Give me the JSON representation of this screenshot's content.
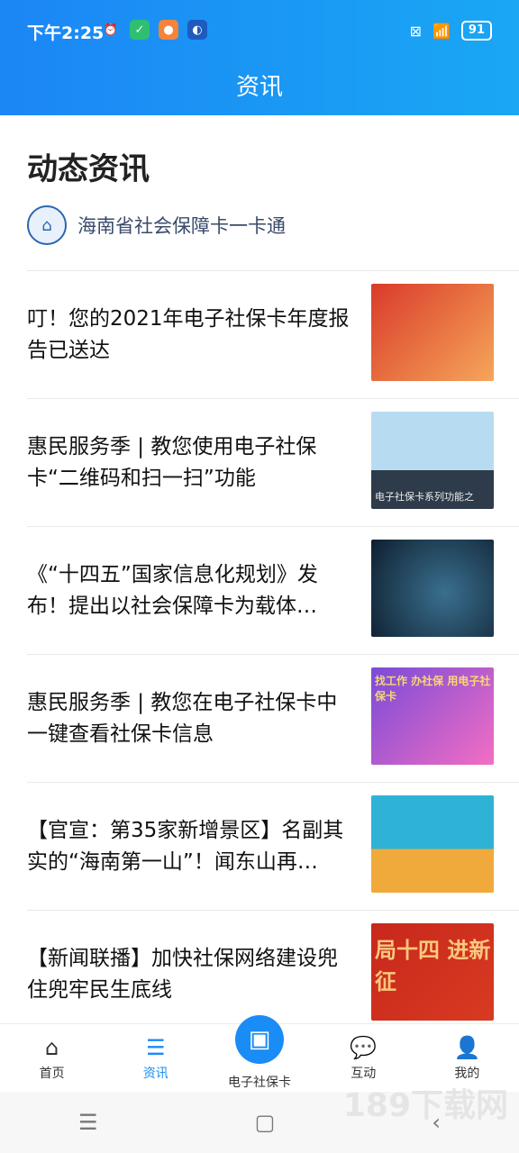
{
  "status": {
    "time": "下午2:25",
    "battery": "91"
  },
  "header": {
    "title": "资讯"
  },
  "section": {
    "title": "动态资讯",
    "source_name": "海南省社会保障卡一卡通"
  },
  "news": [
    {
      "title": "叮！您的2021年电子社保卡年度报告已送达",
      "thumb_caption": "",
      "thumb_color_1": "#d93b2a",
      "thumb_color_2": "#f6a65a"
    },
    {
      "title": "惠民服务季 | 教您使用电子社保卡“二维码和扫一扫”功能",
      "thumb_caption": "电子社保卡系列功能之",
      "thumb_color_1": "#b7dcf2",
      "thumb_color_2": "#2e3b4a"
    },
    {
      "title": "《“十四五”国家信息化规划》发布！提出以社会保障卡为载体…",
      "thumb_caption": "",
      "thumb_color_1": "#0e1f2f",
      "thumb_color_2": "#3a6f8e"
    },
    {
      "title": "惠民服务季 | 教您在电子社保卡中一键查看社保卡信息",
      "thumb_caption": "找工作 办社保 用电子社保卡",
      "thumb_color_1": "#7a4bd8",
      "thumb_color_2": "#f36ec3"
    },
    {
      "title": "【官宣：第35家新增景区】名副其实的“海南第一山”！闻东山再…",
      "thumb_caption": "",
      "thumb_color_1": "#2eb3d6",
      "thumb_color_2": "#f0a93b"
    },
    {
      "title": "【新闻联播】加快社保网络建设兜住兜牢民生底线",
      "thumb_caption": "局十四 进新征",
      "thumb_color_1": "#c7281b",
      "thumb_color_2": "#d93a22"
    }
  ],
  "tabs": [
    {
      "label": "首页",
      "icon": "home-icon"
    },
    {
      "label": "资讯",
      "icon": "news-icon"
    },
    {
      "label": "电子社保卡",
      "icon": "card-icon"
    },
    {
      "label": "互动",
      "icon": "chat-icon"
    },
    {
      "label": "我的",
      "icon": "user-icon"
    }
  ],
  "colors": {
    "accent": "#1a8cf5",
    "header_gradient_start": "#1b86f5",
    "header_gradient_end": "#1aa7f4"
  },
  "watermark": "189下载网"
}
